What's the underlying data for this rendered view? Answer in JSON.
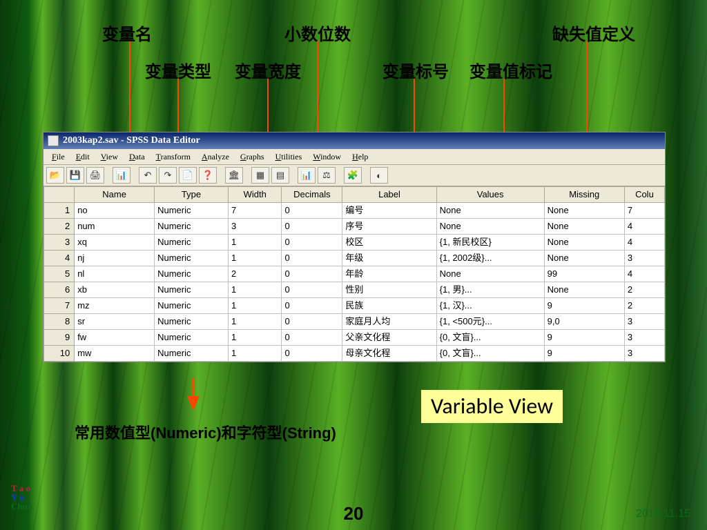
{
  "annotations": {
    "top1_a": "变量名",
    "top1_b": "小数位数",
    "top1_c": "缺失值定义",
    "top2_a": "变量类型",
    "top2_b": "变量宽度",
    "top2_c": "变量标号",
    "top2_d": "变量值标记"
  },
  "window": {
    "title": "2003kap2.sav - SPSS Data Editor",
    "menu": [
      "File",
      "Edit",
      "View",
      "Data",
      "Transform",
      "Analyze",
      "Graphs",
      "Utilities",
      "Window",
      "Help"
    ]
  },
  "columns": [
    "Name",
    "Type",
    "Width",
    "Decimals",
    "Label",
    "Values",
    "Missing",
    "Colu"
  ],
  "rows": [
    {
      "n": "1",
      "name": "no",
      "type": "Numeric",
      "width": "7",
      "dec": "0",
      "label": "编号",
      "values": "None",
      "missing": "None",
      "col": "7"
    },
    {
      "n": "2",
      "name": "num",
      "type": "Numeric",
      "width": "3",
      "dec": "0",
      "label": "序号",
      "values": "None",
      "missing": "None",
      "col": "4"
    },
    {
      "n": "3",
      "name": "xq",
      "type": "Numeric",
      "width": "1",
      "dec": "0",
      "label": "校区",
      "values": "{1, 新民校区}",
      "missing": "None",
      "col": "4"
    },
    {
      "n": "4",
      "name": "nj",
      "type": "Numeric",
      "width": "1",
      "dec": "0",
      "label": "年级",
      "values": "{1, 2002级}...",
      "missing": "None",
      "col": "3"
    },
    {
      "n": "5",
      "name": "nl",
      "type": "Numeric",
      "width": "2",
      "dec": "0",
      "label": "年龄",
      "values": "None",
      "missing": "99",
      "col": "4"
    },
    {
      "n": "6",
      "name": "xb",
      "type": "Numeric",
      "width": "1",
      "dec": "0",
      "label": "性别",
      "values": "{1, 男}...",
      "missing": "None",
      "col": "2"
    },
    {
      "n": "7",
      "name": "mz",
      "type": "Numeric",
      "width": "1",
      "dec": "0",
      "label": "民族",
      "values": "{1, 汉}...",
      "missing": "9",
      "col": "2"
    },
    {
      "n": "8",
      "name": "sr",
      "type": "Numeric",
      "width": "1",
      "dec": "0",
      "label": "家庭月人均",
      "values": "{1, <500元}...",
      "missing": "9,0",
      "col": "3"
    },
    {
      "n": "9",
      "name": "fw",
      "type": "Numeric",
      "width": "1",
      "dec": "0",
      "label": "父亲文化程",
      "values": "{0, 文盲}...",
      "missing": "9",
      "col": "3"
    },
    {
      "n": "10",
      "name": "mw",
      "type": "Numeric",
      "width": "1",
      "dec": "0",
      "label": "母亲文化程",
      "values": "{0, 文盲}...",
      "missing": "9",
      "col": "3"
    }
  ],
  "callout": "Variable View",
  "note": "常用数值型(Numeric)和字符型(String)",
  "page": "20",
  "date": "2018.11.15",
  "logo": {
    "l1": "T a o",
    "l2": "Y u",
    "l3": "Chun"
  },
  "toolbar_icons": [
    "📂",
    "💾",
    "🖨",
    "",
    "📊",
    "",
    "↶",
    "↷",
    "📄",
    "❓",
    "",
    "🏛",
    "",
    "▦",
    "▤",
    "",
    "📊",
    "⚖",
    "",
    "🧩",
    "",
    "◐"
  ]
}
